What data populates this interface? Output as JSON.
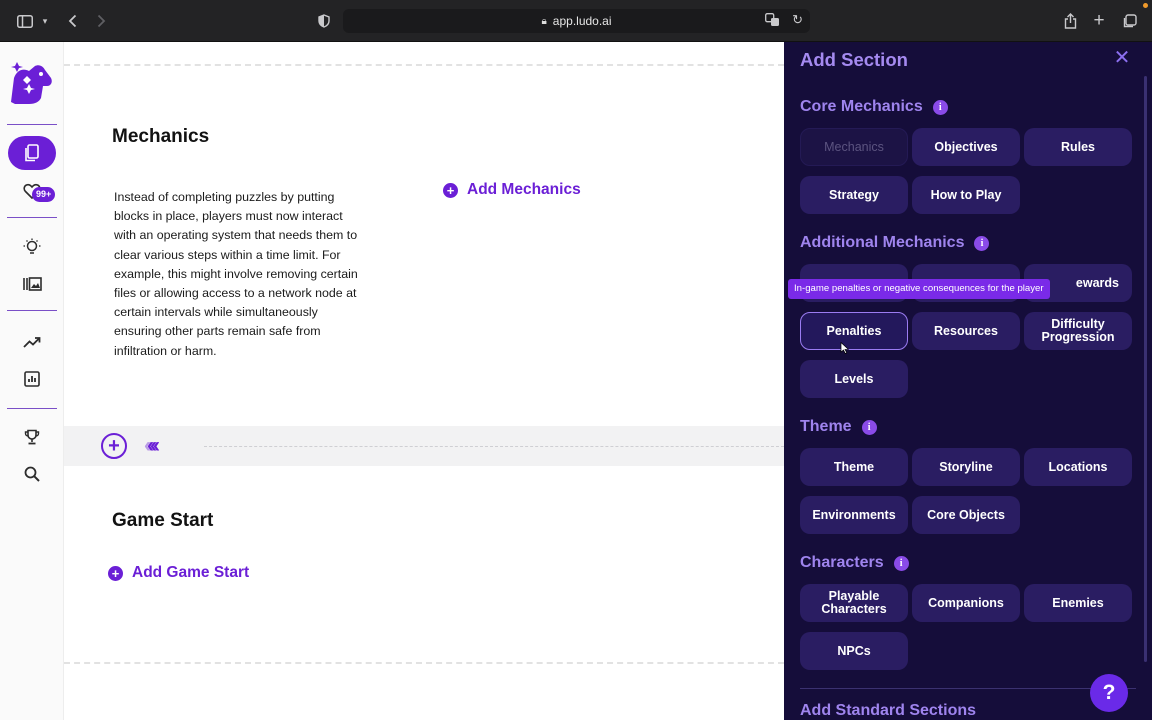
{
  "browser": {
    "url": "app.ludo.ai"
  },
  "rail": {
    "badge": "99+"
  },
  "main": {
    "mechanics": {
      "title": "Mechanics",
      "description": "Instead of completing puzzles by putting blocks in place, players must now interact with an operating system that needs them to clear various steps within a time limit. For example, this might involve removing certain files or allowing access to a network node at certain intervals while simultaneously ensuring other parts remain safe from infiltration or harm.",
      "add_label": "Add Mechanics"
    },
    "game_start": {
      "title": "Game Start",
      "add_label": "Add Game Start"
    }
  },
  "panel": {
    "title": "Add Section",
    "groups": {
      "core": {
        "title": "Core Mechanics",
        "items": [
          "Mechanics",
          "Objectives",
          "Rules",
          "Strategy",
          "How to Play"
        ]
      },
      "additional": {
        "title": "Additional Mechanics",
        "items": [
          "",
          "",
          "ewards",
          "Penalties",
          "Resources",
          "Difficulty Progression",
          "Levels"
        ]
      },
      "theme": {
        "title": "Theme",
        "items": [
          "Theme",
          "Storyline",
          "Locations",
          "Environments",
          "Core Objects"
        ]
      },
      "characters": {
        "title": "Characters",
        "items": [
          "Playable Characters",
          "Companions",
          "Enemies",
          "NPCs"
        ]
      }
    },
    "tooltip": "In-game penalties or negative consequences for the player",
    "standard_title": "Add Standard Sections",
    "help": "?"
  },
  "colors": {
    "brand": "#6b1fd6",
    "panel_bg": "#150d3a",
    "chip_bg": "#2a1d62",
    "panel_heading": "#9f84ee"
  }
}
